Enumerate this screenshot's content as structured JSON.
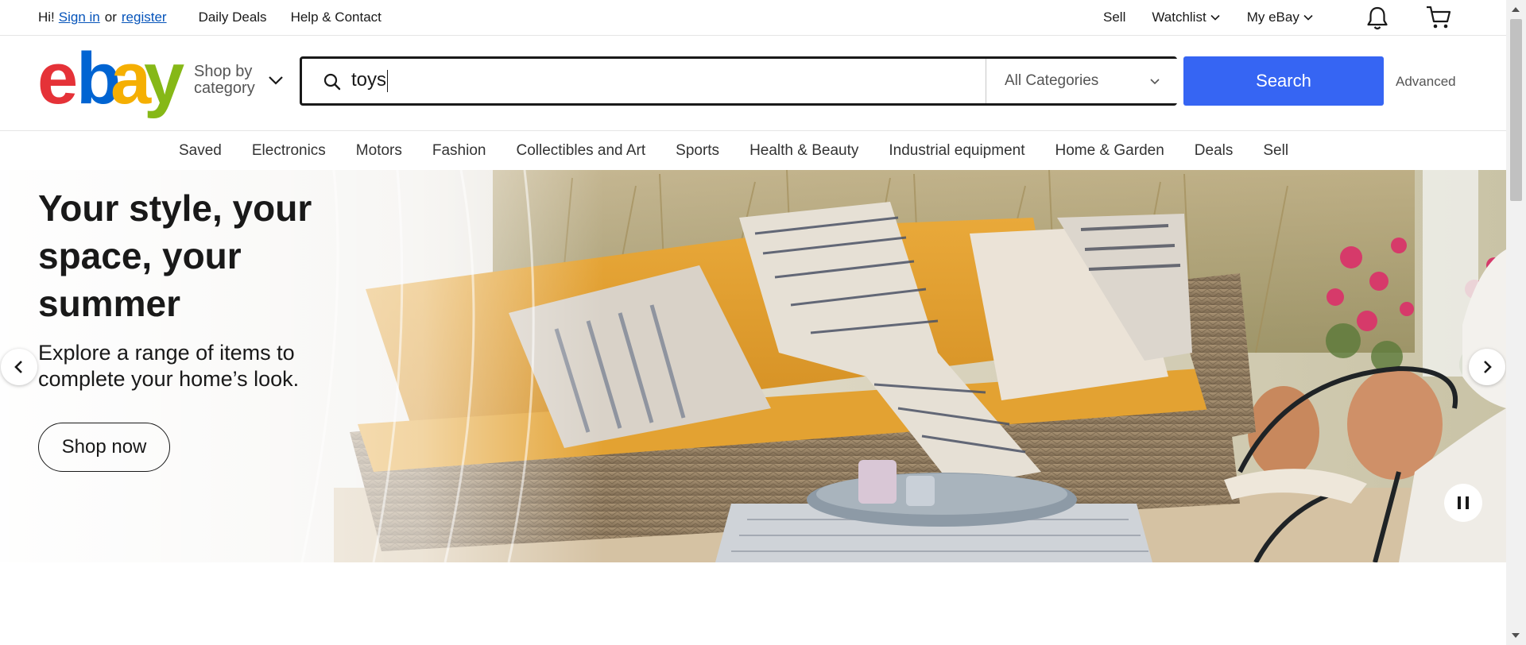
{
  "topbar": {
    "greeting": "Hi!",
    "sign_in": "Sign in",
    "or": "or",
    "register": "register",
    "daily_deals": "Daily Deals",
    "help": "Help & Contact",
    "sell": "Sell",
    "watchlist": "Watchlist",
    "my_ebay": "My eBay"
  },
  "header": {
    "logo_letters": [
      "e",
      "b",
      "a",
      "y"
    ],
    "logo_colors": [
      "#e53238",
      "#0064d2",
      "#f5af02",
      "#86b817"
    ],
    "shop_by_line1": "Shop by",
    "shop_by_line2": "category",
    "search_query": "toys",
    "category_selected": "All Categories",
    "search_button": "Search",
    "advanced": "Advanced"
  },
  "nav": {
    "items": [
      "Saved",
      "Electronics",
      "Motors",
      "Fashion",
      "Collectibles and Art",
      "Sports",
      "Health & Beauty",
      "Industrial equipment",
      "Home & Garden",
      "Deals",
      "Sell"
    ]
  },
  "hero": {
    "title": "Your style, your space, your summer",
    "subtitle": "Explore a range of items to complete your home’s look.",
    "cta": "Shop now"
  },
  "colors": {
    "accent": "#3665f3",
    "link": "#0654ba"
  }
}
